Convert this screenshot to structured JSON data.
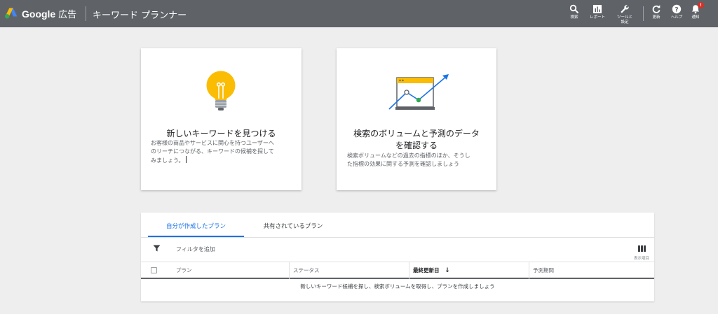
{
  "header": {
    "brand_google": "Google",
    "brand_ads": "広告",
    "tool_title": "キーワード プランナー",
    "actions": [
      {
        "label": "検索",
        "icon": "search-icon"
      },
      {
        "label": "レポート",
        "icon": "reports-icon"
      },
      {
        "label": "ツールと設定",
        "icon": "wrench-icon"
      },
      {
        "label": "更新",
        "icon": "refresh-icon"
      },
      {
        "label": "ヘルプ",
        "icon": "help-icon"
      },
      {
        "label": "通知",
        "icon": "bell-icon",
        "badge": "!"
      }
    ],
    "tool_label_line1": "ツールと",
    "tool_label_line2": "設定"
  },
  "cards": {
    "discover": {
      "title": "新しいキーワードを見つける",
      "desc_lines": [
        "お客様の商品やサービスに関心を持つユーザーへ",
        "のリーチにつながる、キーワードの候補を探して",
        "みましょう。"
      ]
    },
    "forecast": {
      "title_line1": "検索のボリュームと予測のデータ",
      "title_line2": "を確認する",
      "desc_lines": [
        "検索ボリュームなどの過去の指標のほか、そうし",
        "た指標の効果に関する予測を確認しましょう"
      ]
    }
  },
  "plans": {
    "tabs": [
      "自分が作成したプラン",
      "共有されているプラン"
    ],
    "filter_label": "フィルタを追加",
    "columns_label": "表示項目",
    "columns": [
      "プラン",
      "ステータス",
      "最終更新日",
      "予測期間"
    ],
    "sort_arrow": "↓",
    "empty_message": "新しいキーワード候補を探し、検索ボリュームを取得し、プランを作成しましょう"
  },
  "colors": {
    "header_bg": "#5f6368",
    "accent_blue": "#1a73e8",
    "bulb_yellow": "#fbbc04",
    "chart_green": "#34a853",
    "badge_red": "#d93025"
  }
}
